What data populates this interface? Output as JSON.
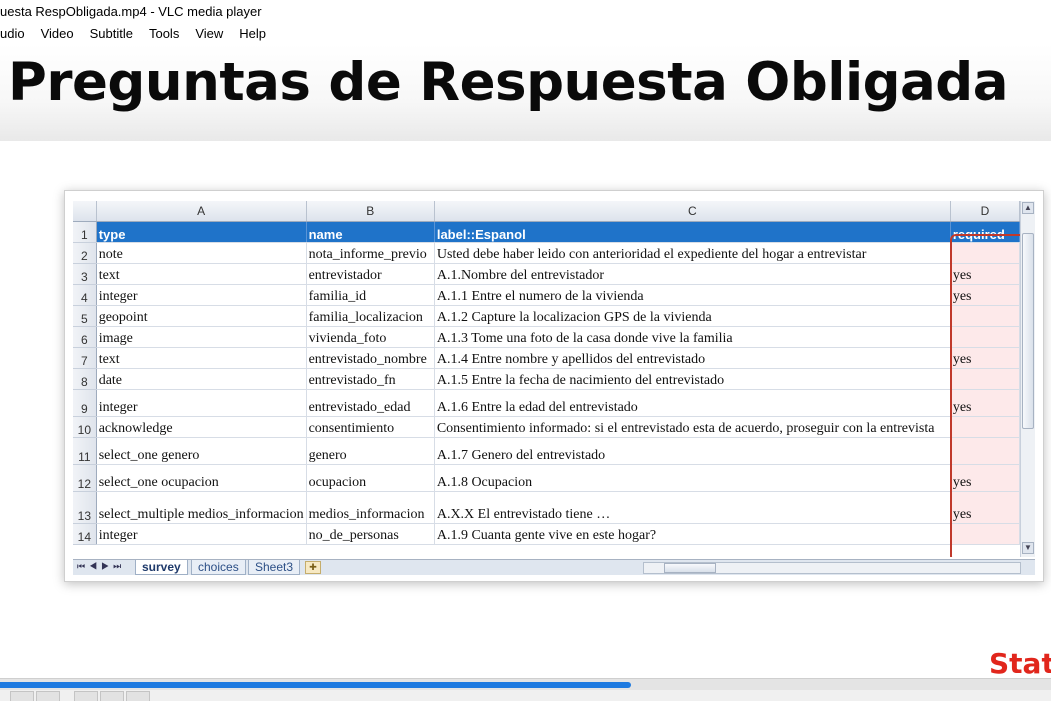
{
  "window": {
    "title": "uesta RespObligada.mp4 - VLC media player"
  },
  "menu": [
    "udio",
    "Video",
    "Subtitle",
    "Tools",
    "View",
    "Help"
  ],
  "slide": {
    "title": "Preguntas de Respuesta Obligada",
    "logo_fragment": "Stat"
  },
  "sheet": {
    "columns": [
      "A",
      "B",
      "C",
      "D"
    ],
    "rows": [
      {
        "n": "1",
        "type": "type",
        "name": "name",
        "label": "label::Espanol",
        "required": "required"
      },
      {
        "n": "2",
        "type": "note",
        "name": "nota_informe_previo",
        "label": "Usted debe haber leido con anterioridad el expediente del hogar a entrevistar",
        "required": ""
      },
      {
        "n": "3",
        "type": "text",
        "name": "entrevistador",
        "label": "A.1.Nombre del entrevistador",
        "required": "yes"
      },
      {
        "n": "4",
        "type": "integer",
        "name": "familia_id",
        "label": "A.1.1 Entre el numero de la vivienda",
        "required": "yes"
      },
      {
        "n": "5",
        "type": "geopoint",
        "name": "familia_localizacion",
        "label": "A.1.2 Capture la localizacion GPS de la vivienda",
        "required": ""
      },
      {
        "n": "6",
        "type": "image",
        "name": "vivienda_foto",
        "label": "A.1.3 Tome una foto de la casa donde vive la familia",
        "required": ""
      },
      {
        "n": "7",
        "type": "text",
        "name": "entrevistado_nombre",
        "label": "A.1.4 Entre nombre y apellidos del entrevistado",
        "required": "yes"
      },
      {
        "n": "8",
        "type": "date",
        "name": "entrevistado_fn",
        "label": "A.1.5 Entre la fecha de nacimiento del entrevistado",
        "required": ""
      },
      {
        "n": "9",
        "type": "integer",
        "name": "entrevistado_edad",
        "label": "A.1.6 Entre la edad del entrevistado",
        "required": "yes"
      },
      {
        "n": "10",
        "type": "acknowledge",
        "name": "consentimiento",
        "label": "Consentimiento informado: si el entrevistado esta de acuerdo, proseguir con la entrevista",
        "required": ""
      },
      {
        "n": "11",
        "type": "select_one genero",
        "name": "genero",
        "label": "A.1.7 Genero del entrevistado",
        "required": ""
      },
      {
        "n": "12",
        "type": "select_one ocupacion",
        "name": "ocupacion",
        "label": "A.1.8 Ocupacion",
        "required": "yes"
      },
      {
        "n": "13",
        "type": "select_multiple medios_informacion",
        "name": "medios_informacion",
        "label": "A.X.X El entrevistado tiene …",
        "required": "yes"
      },
      {
        "n": "14",
        "type": "integer",
        "name": "no_de_personas",
        "label": "A.1.9 Cuanta gente vive en este hogar?",
        "required": ""
      }
    ],
    "tabs": [
      "survey",
      "choices",
      "Sheet3"
    ],
    "active_tab": "survey"
  },
  "player": {
    "progress": 0.6
  },
  "colors": {
    "header_fill": "#1f73c9",
    "required_highlight": "#fde9ea",
    "box_outline": "#c0392b",
    "seek": "#1e7ae0"
  }
}
